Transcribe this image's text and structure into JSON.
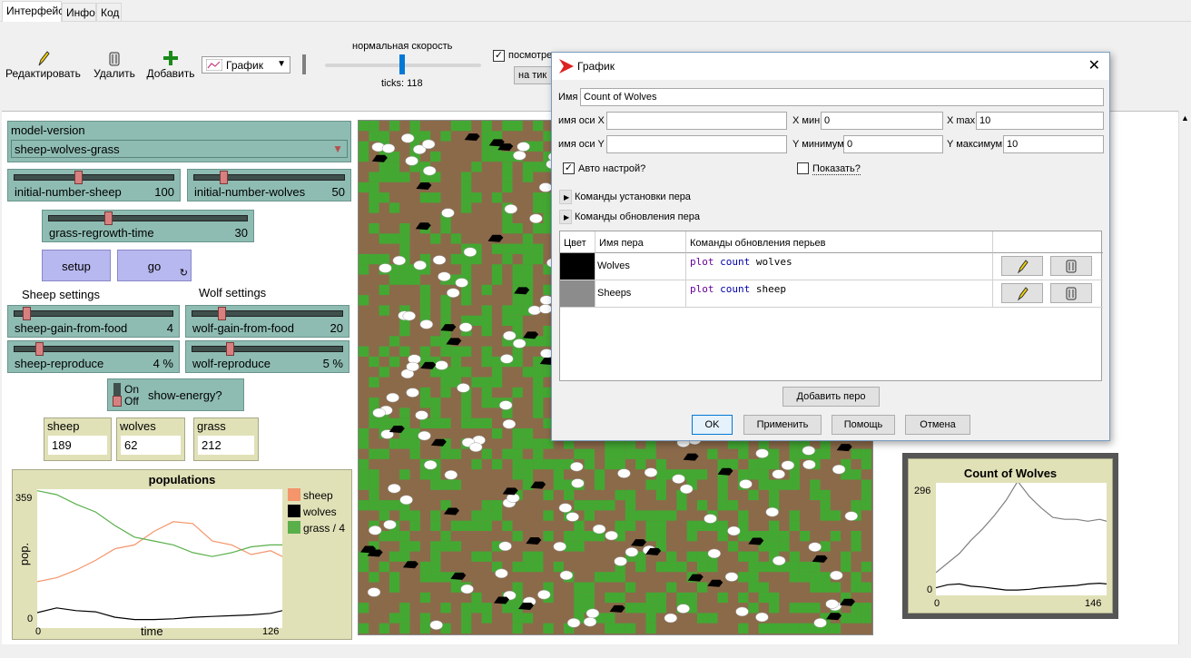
{
  "tabs": [
    {
      "label": "Интерфейс"
    },
    {
      "label": "Инфо"
    },
    {
      "label": "Код"
    }
  ],
  "toolbar": {
    "edit_label": "Редактировать",
    "delete_label": "Удалить",
    "add_label": "Добавить",
    "widget_type": "График",
    "speed_label": "нормальная скорость",
    "ticks_label": "ticks: 118",
    "view_updates_label": "посмотре",
    "update_mode": "на тик"
  },
  "widgets": {
    "model_version": {
      "label": "model-version",
      "value": "sheep-wolves-grass"
    },
    "initial_number_sheep": {
      "name": "initial-number-sheep",
      "value": "100",
      "fraction": 0.28
    },
    "initial_number_wolves": {
      "name": "initial-number-wolves",
      "value": "50",
      "fraction": 0.2
    },
    "grass_regrowth_time": {
      "name": "grass-regrowth-time",
      "value": "30",
      "fraction": 0.3
    },
    "setup_label": "setup",
    "go_label": "go",
    "sheep_settings": "Sheep settings",
    "wolf_settings": "Wolf settings",
    "sheep_gain_from_food": {
      "name": "sheep-gain-from-food",
      "value": "4",
      "fraction": 0.05
    },
    "wolf_gain_from_food": {
      "name": "wolf-gain-from-food",
      "value": "20",
      "fraction": 0.2
    },
    "sheep_reproduce": {
      "name": "sheep-reproduce",
      "value": "4 %",
      "fraction": 0.16
    },
    "wolf_reproduce": {
      "name": "wolf-reproduce",
      "value": "5 %",
      "fraction": 0.25
    },
    "show_energy": {
      "on": "On",
      "off": "Off",
      "name": "show-energy?"
    },
    "monitors": [
      {
        "label": "sheep",
        "value": "189"
      },
      {
        "label": "wolves",
        "value": "62"
      },
      {
        "label": "grass",
        "value": "212"
      }
    ]
  },
  "populations_plot": {
    "title": "populations",
    "ylabel": "pop.",
    "xlabel": "time",
    "ymin_label": "0",
    "ymax_label": "359",
    "xmin_label": "0",
    "xmax_label": "126",
    "legend": [
      {
        "name": "sheep",
        "color": "#f4956b"
      },
      {
        "name": "wolves",
        "color": "#000000"
      },
      {
        "name": "grass / 4",
        "color": "#59b04a"
      }
    ]
  },
  "wolves_plot": {
    "title": "Count of Wolves",
    "ymin_label": "0",
    "ymax_label": "296",
    "xmin_label": "0",
    "xmax_label": "146"
  },
  "chart_data": [
    {
      "type": "line",
      "title": "populations",
      "xlabel": "time",
      "ylabel": "pop.",
      "xlim": [
        0,
        126
      ],
      "ylim": [
        0,
        359
      ],
      "x": [
        0,
        10,
        20,
        30,
        40,
        50,
        60,
        70,
        80,
        90,
        100,
        110,
        120,
        126
      ],
      "series": [
        {
          "name": "sheep",
          "color": "#f4956b",
          "values": [
            120,
            130,
            150,
            175,
            205,
            215,
            250,
            275,
            270,
            225,
            215,
            190,
            200,
            185
          ]
        },
        {
          "name": "wolves",
          "color": "#000000",
          "values": [
            40,
            52,
            45,
            42,
            28,
            22,
            22,
            24,
            28,
            30,
            32,
            34,
            38,
            45
          ]
        },
        {
          "name": "grass / 4",
          "color": "#59b04a",
          "values": [
            355,
            345,
            320,
            300,
            265,
            235,
            225,
            215,
            195,
            185,
            195,
            210,
            215,
            215
          ]
        }
      ]
    },
    {
      "type": "line",
      "title": "Count of Wolves",
      "xlim": [
        0,
        146
      ],
      "ylim": [
        0,
        296
      ],
      "x": [
        0,
        10,
        20,
        30,
        40,
        50,
        60,
        70,
        80,
        90,
        100,
        110,
        120,
        130,
        140,
        146
      ],
      "series": [
        {
          "name": "Wolves",
          "color": "#000000",
          "values": [
            20,
            28,
            30,
            24,
            22,
            18,
            14,
            14,
            16,
            20,
            22,
            24,
            26,
            30,
            32,
            30
          ]
        },
        {
          "name": "Sheeps",
          "color": "#808080",
          "values": [
            60,
            85,
            110,
            145,
            175,
            210,
            250,
            300,
            260,
            230,
            205,
            200,
            200,
            195,
            200,
            195
          ]
        }
      ]
    }
  ],
  "dialog": {
    "title": "График",
    "name_label": "Имя",
    "name_value": "Count of Wolves",
    "x_axis_label": "имя оси X",
    "x_axis_value": "",
    "xmin_label": "X мин",
    "xmin_value": "0",
    "xmax_label": "X max",
    "xmax_value": "10",
    "y_axis_label": "имя оси Y",
    "y_axis_value": "",
    "ymin_label": "Y минимум",
    "ymin_value": "0",
    "ymax_label": "Y максимум",
    "ymax_value": "10",
    "autoscale_label": "Авто настрой?",
    "show_legend_label": "Показать?",
    "setup_commands": "Команды установки пера",
    "update_commands": "Команды обновления пера",
    "table_headers": {
      "color": "Цвет",
      "name": "Имя пера",
      "cmds": "Команды обновления перьев"
    },
    "pens": [
      {
        "color": "#000000",
        "name": "Wolves",
        "cmd_kw": "plot",
        "cmd_prim": "count",
        "cmd_arg": "wolves"
      },
      {
        "color": "#8c8c8c",
        "name": "Sheeps",
        "cmd_kw": "plot",
        "cmd_prim": "count",
        "cmd_arg": "sheep"
      }
    ],
    "add_pen": "Добавить перо",
    "ok": "OK",
    "apply": "Применить",
    "help": "Помощь",
    "cancel": "Отмена"
  }
}
